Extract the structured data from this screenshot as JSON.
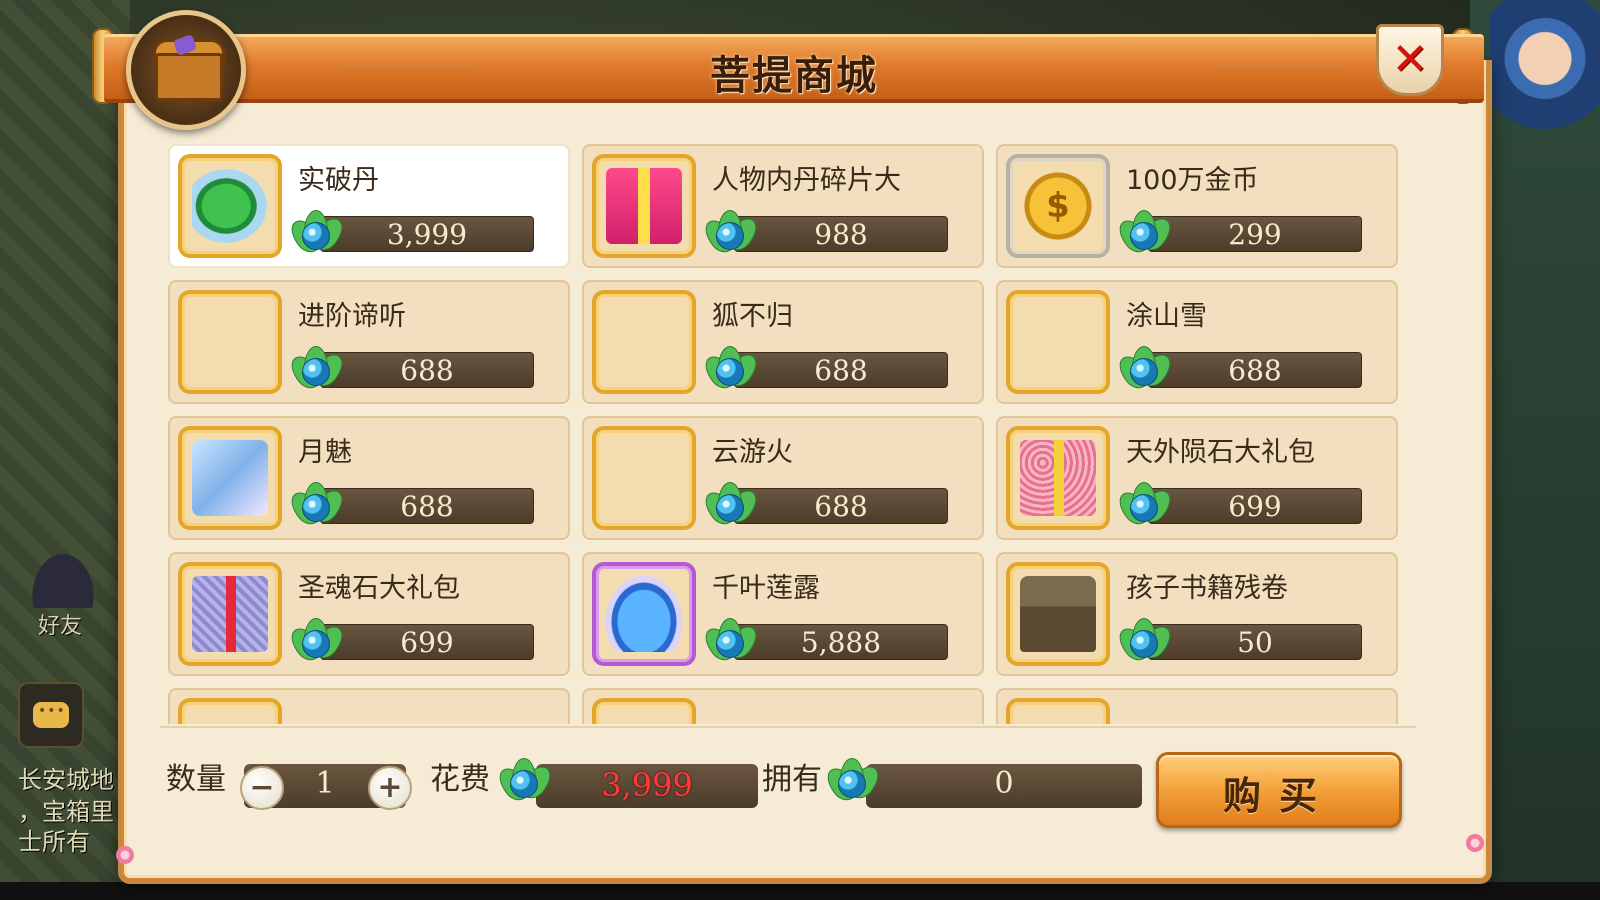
{
  "background": {
    "chat_lines": [
      "长安城地",
      "，宝箱里",
      "士所有"
    ],
    "friend_label": "好友"
  },
  "window": {
    "title": "菩提商城",
    "close_symbol": "✕"
  },
  "items": [
    {
      "name": "实破丹",
      "price": "3,999",
      "art": "egg",
      "frame": "gold",
      "selected": true
    },
    {
      "name": "人物内丹碎片大",
      "price": "988",
      "art": "gift-red",
      "frame": "gold"
    },
    {
      "name": "100万金币",
      "price": "299",
      "art": "coin",
      "frame": "silver"
    },
    {
      "name": "进阶谛听",
      "price": "688",
      "art": "",
      "frame": "gold"
    },
    {
      "name": "狐不归",
      "price": "688",
      "art": "",
      "frame": "gold"
    },
    {
      "name": "涂山雪",
      "price": "688",
      "art": "",
      "frame": "gold"
    },
    {
      "name": "月魅",
      "price": "688",
      "art": "fairy",
      "frame": "gold"
    },
    {
      "name": "云游火",
      "price": "688",
      "art": "",
      "frame": "gold"
    },
    {
      "name": "天外陨石大礼包",
      "price": "699",
      "art": "gift-pink",
      "frame": "gold"
    },
    {
      "name": "圣魂石大礼包",
      "price": "699",
      "art": "gift-purple",
      "frame": "gold"
    },
    {
      "name": "千叶莲露",
      "price": "5,888",
      "art": "vase",
      "frame": "purple"
    },
    {
      "name": "孩子书籍残卷",
      "price": "50",
      "art": "chest",
      "frame": "gold"
    },
    {
      "name": "",
      "price": "",
      "art": "",
      "frame": "gold"
    },
    {
      "name": "",
      "price": "",
      "art": "",
      "frame": "gold"
    },
    {
      "name": "",
      "price": "",
      "art": "",
      "frame": "gold"
    }
  ],
  "purchase": {
    "quantity_label": "数量",
    "quantity": "1",
    "minus": "−",
    "plus": "+",
    "cost_label": "花费",
    "cost": "3,999",
    "own_label": "拥有",
    "owned": "0",
    "buy_label": "购买"
  },
  "colors": {
    "accent": "#e07b2c",
    "cost_text": "#ff3a3a",
    "frame_gold": "#e4a62a",
    "frame_purple": "#b35ad0"
  },
  "icons": {
    "currency": "green-gem-leaf-icon",
    "header": "treasure-chest-icon",
    "close": "close-icon"
  }
}
